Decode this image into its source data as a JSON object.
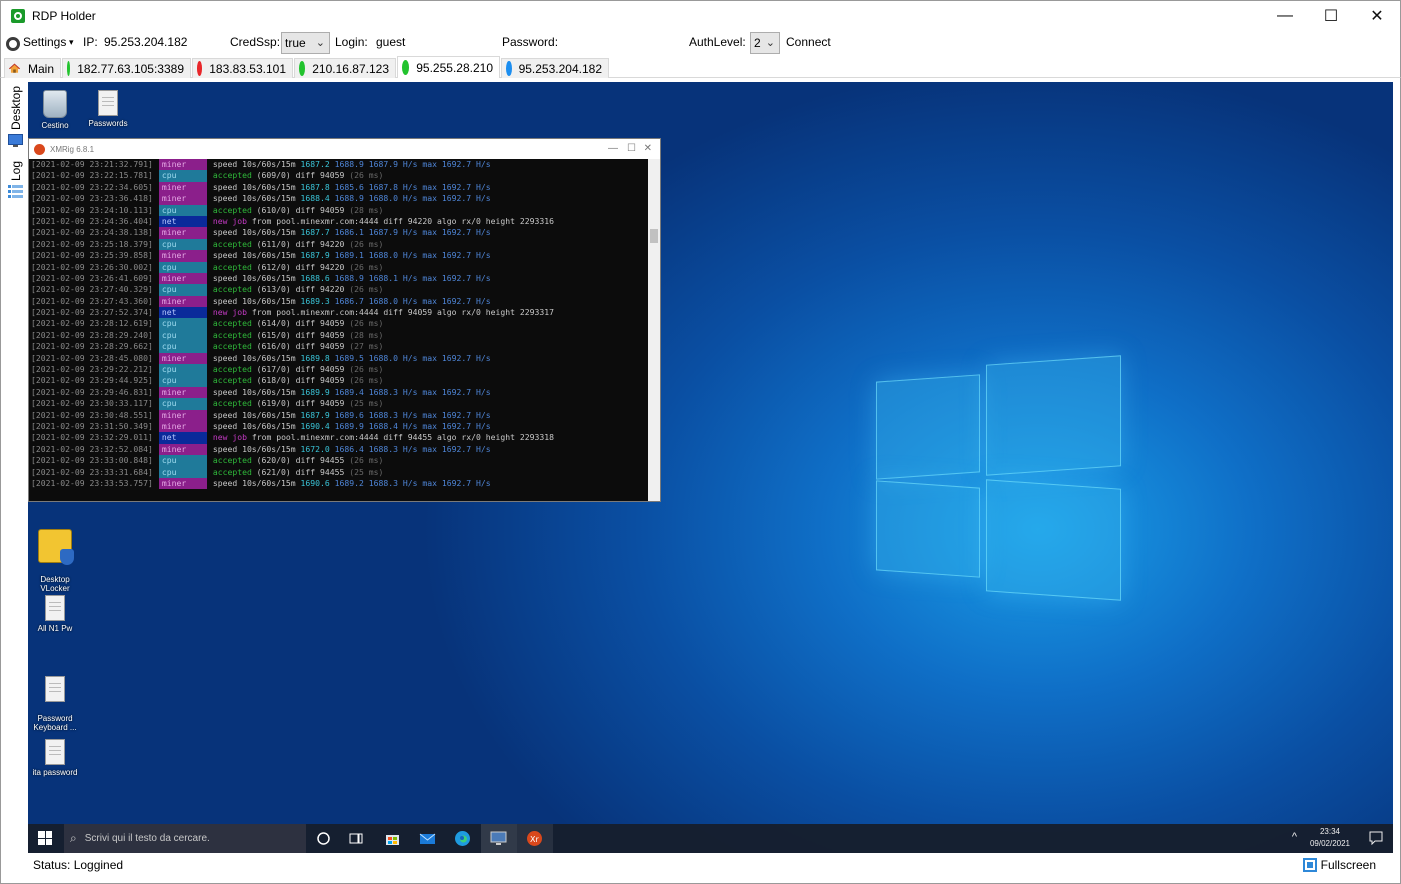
{
  "window": {
    "title": "RDP Holder",
    "controls": [
      "—",
      "☐",
      "✕"
    ]
  },
  "toolbar": {
    "settings_label": "Settings",
    "settings_caret": "▾",
    "ip_label": "IP:",
    "ip_value": "95.253.204.182",
    "credssp_label": "CredSsp:",
    "credssp_value": "true",
    "login_label": "Login:",
    "login_value": "guest",
    "password_label": "Password:",
    "authlevel_label": "AuthLevel:",
    "authlevel_value": "2",
    "connect_label": "Connect"
  },
  "tabs": [
    {
      "label": "Main",
      "icon": "house-icon"
    },
    {
      "label": "182.77.63.105:3389",
      "status": "green",
      "color": "#22c32e"
    },
    {
      "label": "183.83.53.101",
      "status": "red",
      "color": "#e8262a"
    },
    {
      "label": "210.16.87.123",
      "status": "green",
      "color": "#22c32e"
    },
    {
      "label": "95.255.28.210",
      "status": "green",
      "color": "#22c32e"
    },
    {
      "label": "95.253.204.182",
      "status": "blue",
      "color": "#1c8ef0"
    }
  ],
  "active_tab": 4,
  "side_tabs": [
    {
      "label": "Desktop"
    },
    {
      "label": "Log"
    }
  ],
  "desktop_icons": [
    {
      "label": "Cestino",
      "icon": "recycle-bin-icon"
    },
    {
      "label": "Passwords",
      "icon": "file-icon"
    },
    {
      "label": "Desktop\nVLocker",
      "icon": "lock-icon"
    },
    {
      "label": "All N1 Pw",
      "icon": "file-icon"
    },
    {
      "label": "Password\nKeyboard ...",
      "icon": "file-icon"
    },
    {
      "label": "ita password",
      "icon": "file-icon"
    }
  ],
  "console": {
    "title": "XMRig 6.8.1",
    "lines": [
      {
        "ts": "[2021-02-09 23:21:32.791]",
        "tag": "miner",
        "text": "speed 10s/60s/15m ",
        "v": [
          "1687.2",
          "1688.9",
          "1687.9"
        ],
        "tail": " H/s max 1692.7 H/s"
      },
      {
        "ts": "[2021-02-09 23:22:15.781]",
        "tag": "cpu",
        "acc": "accepted",
        "text": " (609/0) diff 94059 ",
        "ms": "(26 ms)"
      },
      {
        "ts": "[2021-02-09 23:22:34.605]",
        "tag": "miner",
        "text": "speed 10s/60s/15m ",
        "v": [
          "1687.8",
          "1685.6",
          "1687.8"
        ],
        "tail": " H/s max 1692.7 H/s"
      },
      {
        "ts": "[2021-02-09 23:23:36.418]",
        "tag": "miner",
        "text": "speed 10s/60s/15m ",
        "v": [
          "1688.4",
          "1688.9",
          "1688.0"
        ],
        "tail": " H/s max 1692.7 H/s"
      },
      {
        "ts": "[2021-02-09 23:24:10.113]",
        "tag": "cpu",
        "acc": "accepted",
        "text": " (610/0) diff 94059 ",
        "ms": "(28 ms)"
      },
      {
        "ts": "[2021-02-09 23:24:36.404]",
        "tag": "net",
        "job": "new job",
        "text": " from pool.minexmr.com:4444 diff 94220 algo rx/0 height 2293316"
      },
      {
        "ts": "[2021-02-09 23:24:38.138]",
        "tag": "miner",
        "text": "speed 10s/60s/15m ",
        "v": [
          "1687.7",
          "1686.1",
          "1687.9"
        ],
        "tail": " H/s max 1692.7 H/s"
      },
      {
        "ts": "[2021-02-09 23:25:18.379]",
        "tag": "cpu",
        "acc": "accepted",
        "text": " (611/0) diff 94220 ",
        "ms": "(26 ms)"
      },
      {
        "ts": "[2021-02-09 23:25:39.858]",
        "tag": "miner",
        "text": "speed 10s/60s/15m ",
        "v": [
          "1687.9",
          "1689.1",
          "1688.0"
        ],
        "tail": " H/s max 1692.7 H/s"
      },
      {
        "ts": "[2021-02-09 23:26:30.002]",
        "tag": "cpu",
        "acc": "accepted",
        "text": " (612/0) diff 94220 ",
        "ms": "(26 ms)"
      },
      {
        "ts": "[2021-02-09 23:26:41.609]",
        "tag": "miner",
        "text": "speed 10s/60s/15m ",
        "v": [
          "1688.6",
          "1688.9",
          "1688.1"
        ],
        "tail": " H/s max 1692.7 H/s"
      },
      {
        "ts": "[2021-02-09 23:27:40.329]",
        "tag": "cpu",
        "acc": "accepted",
        "text": " (613/0) diff 94220 ",
        "ms": "(26 ms)"
      },
      {
        "ts": "[2021-02-09 23:27:43.360]",
        "tag": "miner",
        "text": "speed 10s/60s/15m ",
        "v": [
          "1689.3",
          "1686.7",
          "1688.0"
        ],
        "tail": " H/s max 1692.7 H/s"
      },
      {
        "ts": "[2021-02-09 23:27:52.374]",
        "tag": "net",
        "job": "new job",
        "text": " from pool.minexmr.com:4444 diff 94059 algo rx/0 height 2293317"
      },
      {
        "ts": "[2021-02-09 23:28:12.619]",
        "tag": "cpu",
        "acc": "accepted",
        "text": " (614/0) diff 94059 ",
        "ms": "(26 ms)"
      },
      {
        "ts": "[2021-02-09 23:28:29.240]",
        "tag": "cpu",
        "acc": "accepted",
        "text": " (615/0) diff 94059 ",
        "ms": "(28 ms)"
      },
      {
        "ts": "[2021-02-09 23:28:29.662]",
        "tag": "cpu",
        "acc": "accepted",
        "text": " (616/0) diff 94059 ",
        "ms": "(27 ms)"
      },
      {
        "ts": "[2021-02-09 23:28:45.080]",
        "tag": "miner",
        "text": "speed 10s/60s/15m ",
        "v": [
          "1689.8",
          "1689.5",
          "1688.0"
        ],
        "tail": " H/s max 1692.7 H/s"
      },
      {
        "ts": "[2021-02-09 23:29:22.212]",
        "tag": "cpu",
        "acc": "accepted",
        "text": " (617/0) diff 94059 ",
        "ms": "(26 ms)"
      },
      {
        "ts": "[2021-02-09 23:29:44.925]",
        "tag": "cpu",
        "acc": "accepted",
        "text": " (618/0) diff 94059 ",
        "ms": "(26 ms)"
      },
      {
        "ts": "[2021-02-09 23:29:46.831]",
        "tag": "miner",
        "text": "speed 10s/60s/15m ",
        "v": [
          "1689.9",
          "1689.4",
          "1688.3"
        ],
        "tail": " H/s max 1692.7 H/s"
      },
      {
        "ts": "[2021-02-09 23:30:33.117]",
        "tag": "cpu",
        "acc": "accepted",
        "text": " (619/0) diff 94059 ",
        "ms": "(25 ms)"
      },
      {
        "ts": "[2021-02-09 23:30:48.551]",
        "tag": "miner",
        "text": "speed 10s/60s/15m ",
        "v": [
          "1687.9",
          "1689.6",
          "1688.3"
        ],
        "tail": " H/s max 1692.7 H/s"
      },
      {
        "ts": "[2021-02-09 23:31:50.349]",
        "tag": "miner",
        "text": "speed 10s/60s/15m ",
        "v": [
          "1690.4",
          "1689.9",
          "1688.4"
        ],
        "tail": " H/s max 1692.7 H/s"
      },
      {
        "ts": "[2021-02-09 23:32:29.011]",
        "tag": "net",
        "job": "new job",
        "text": " from pool.minexmr.com:4444 diff 94455 algo rx/0 height 2293318"
      },
      {
        "ts": "[2021-02-09 23:32:52.084]",
        "tag": "miner",
        "text": "speed 10s/60s/15m ",
        "v": [
          "1672.0",
          "1686.4",
          "1688.3"
        ],
        "tail": " H/s max 1692.7 H/s"
      },
      {
        "ts": "[2021-02-09 23:33:00.848]",
        "tag": "cpu",
        "acc": "accepted",
        "text": " (620/0) diff 94455 ",
        "ms": "(26 ms)"
      },
      {
        "ts": "[2021-02-09 23:33:31.684]",
        "tag": "cpu",
        "acc": "accepted",
        "text": " (621/0) diff 94455 ",
        "ms": "(25 ms)"
      },
      {
        "ts": "[2021-02-09 23:33:53.757]",
        "tag": "miner",
        "text": "speed 10s/60s/15m ",
        "v": [
          "1690.6",
          "1689.2",
          "1688.3"
        ],
        "tail": " H/s max 1692.7 H/s"
      }
    ]
  },
  "taskbar": {
    "search_placeholder": "Scrivi qui il testo da cercare.",
    "time": "23:34",
    "date": "09/02/2021"
  },
  "status": {
    "text": "Status: Loggined",
    "fullscreen_label": "Fullscreen"
  }
}
